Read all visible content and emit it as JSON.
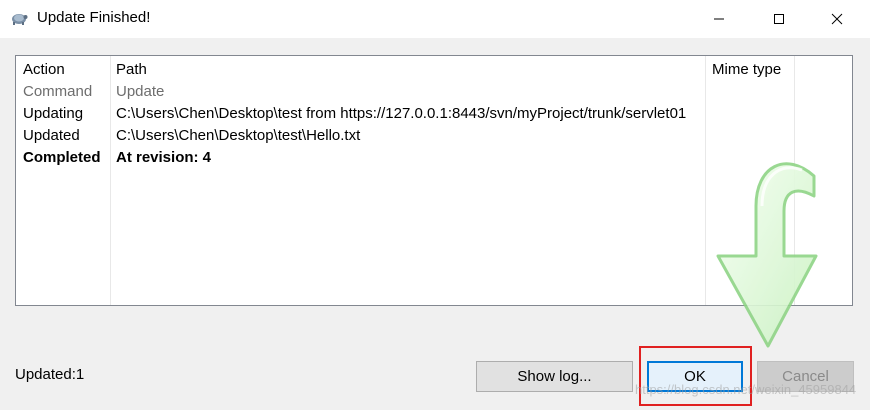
{
  "window": {
    "title": "Update Finished!",
    "icon": "tortoise-svn-icon"
  },
  "list": {
    "columns": [
      "Action",
      "Path",
      "Mime type"
    ],
    "rows": [
      {
        "action": "Command",
        "path": "Update",
        "style": "muted"
      },
      {
        "action": "Updating",
        "path": "C:\\Users\\Chen\\Desktop\\test from https://127.0.0.1:8443/svn/myProject/trunk/servlet01",
        "style": "normal"
      },
      {
        "action": "Updated",
        "path": "C:\\Users\\Chen\\Desktop\\test\\Hello.txt",
        "style": "normal"
      },
      {
        "action": "Completed",
        "path": "At revision: 4",
        "style": "bold"
      }
    ],
    "overlay_icon": "green-update-arrow-icon"
  },
  "status": "Updated:1",
  "buttons": {
    "show_log": "Show log...",
    "ok": "OK",
    "cancel": "Cancel"
  },
  "watermark": "https://blog.csdn.net/weixin_45959844",
  "colors": {
    "highlight": "#e02020",
    "focus_border": "#0078d7"
  }
}
